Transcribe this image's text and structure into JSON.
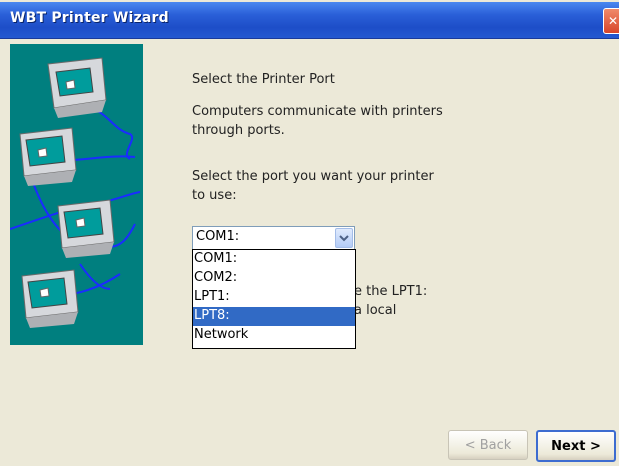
{
  "window": {
    "title": "WBT Printer Wizard",
    "close_icon": "close-icon"
  },
  "heading": "Select the Printer Port",
  "description": "Computers communicate with printers\nthrough ports.",
  "prompt": "Select the port you want your printer\nto use:",
  "port_combo": {
    "value": "COM1:",
    "options": [
      "COM1:",
      "COM2:",
      "LPT1:",
      "LPT8:",
      "Network"
    ],
    "highlighted": "LPT8:"
  },
  "occluded_text": {
    "line1": "e the LPT1:",
    "line2": "a local"
  },
  "buttons": {
    "back": "< Back",
    "next": "Next >"
  },
  "colors": {
    "titlebar": "#2458d0",
    "side_panel": "#007f7f",
    "selection": "#316ac5"
  }
}
